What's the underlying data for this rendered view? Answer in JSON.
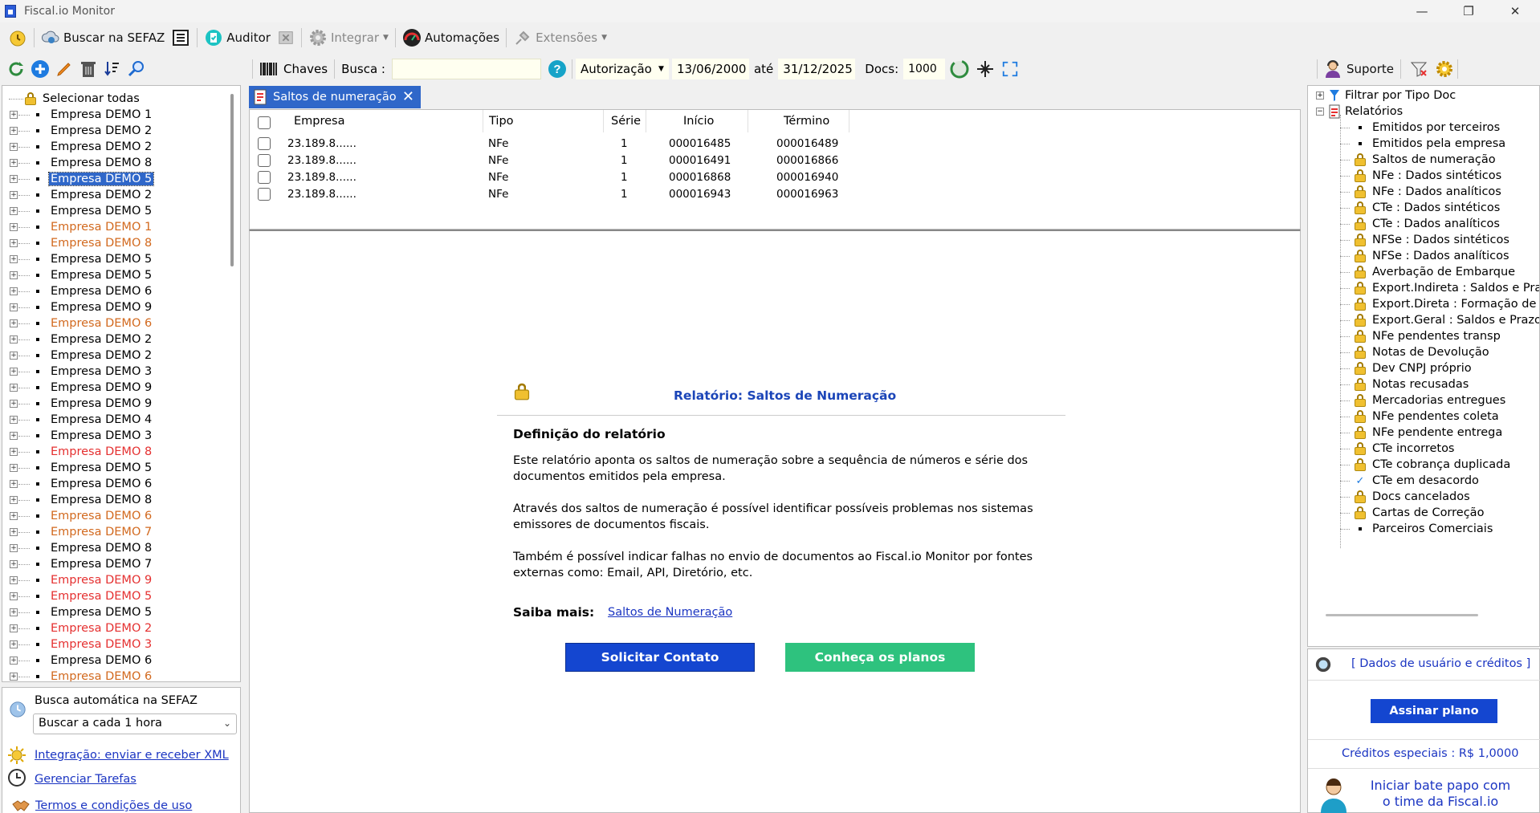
{
  "window": {
    "title": "Fiscal.io Monitor",
    "minimize": "—",
    "maximize": "❐",
    "close": "✕"
  },
  "toolbar": {
    "buscar_sefaz": "Buscar na SEFAZ",
    "auditor": "Auditor",
    "integrar": "Integrar",
    "automacoes": "Automações",
    "extensoes": "Extensões"
  },
  "filterbar": {
    "chaves": "Chaves",
    "busca_label": "Busca :",
    "busca_value": "",
    "autorizacao": "Autorização",
    "date_from": "13/06/2000",
    "ate": "até",
    "date_to": "31/12/2025",
    "docs_label": "Docs:",
    "docs_value": "1000"
  },
  "tree": {
    "select_all": "Selecionar todas",
    "companies": [
      {
        "name": "Empresa DEMO 1",
        "color": "#000000"
      },
      {
        "name": "Empresa DEMO 2",
        "color": "#000000"
      },
      {
        "name": "Empresa DEMO 2",
        "color": "#000000"
      },
      {
        "name": "Empresa DEMO 8",
        "color": "#000000"
      },
      {
        "name": "Empresa DEMO 5",
        "color": "#000000",
        "selected": true
      },
      {
        "name": "Empresa DEMO 2",
        "color": "#000000"
      },
      {
        "name": "Empresa DEMO 5",
        "color": "#000000"
      },
      {
        "name": "Empresa DEMO 1",
        "color": "#d2691e"
      },
      {
        "name": "Empresa DEMO 8",
        "color": "#d2691e"
      },
      {
        "name": "Empresa DEMO 5",
        "color": "#000000"
      },
      {
        "name": "Empresa DEMO 5",
        "color": "#000000"
      },
      {
        "name": "Empresa DEMO 6",
        "color": "#000000"
      },
      {
        "name": "Empresa DEMO 9",
        "color": "#000000"
      },
      {
        "name": "Empresa DEMO 6",
        "color": "#d2691e"
      },
      {
        "name": "Empresa DEMO 2",
        "color": "#000000"
      },
      {
        "name": "Empresa DEMO 2",
        "color": "#000000"
      },
      {
        "name": "Empresa DEMO 3",
        "color": "#000000"
      },
      {
        "name": "Empresa DEMO 9",
        "color": "#000000"
      },
      {
        "name": "Empresa DEMO 9",
        "color": "#000000"
      },
      {
        "name": "Empresa DEMO 4",
        "color": "#000000"
      },
      {
        "name": "Empresa DEMO 3",
        "color": "#000000"
      },
      {
        "name": "Empresa DEMO 8",
        "color": "#e53030"
      },
      {
        "name": "Empresa DEMO 5",
        "color": "#000000"
      },
      {
        "name": "Empresa DEMO 6",
        "color": "#000000"
      },
      {
        "name": "Empresa DEMO 8",
        "color": "#000000"
      },
      {
        "name": "Empresa DEMO 6",
        "color": "#d2691e"
      },
      {
        "name": "Empresa DEMO 7",
        "color": "#d2691e"
      },
      {
        "name": "Empresa DEMO 8",
        "color": "#000000"
      },
      {
        "name": "Empresa DEMO 7",
        "color": "#000000"
      },
      {
        "name": "Empresa DEMO 9",
        "color": "#e53030"
      },
      {
        "name": "Empresa DEMO 5",
        "color": "#e53030"
      },
      {
        "name": "Empresa DEMO 5",
        "color": "#000000"
      },
      {
        "name": "Empresa DEMO 2",
        "color": "#e53030"
      },
      {
        "name": "Empresa DEMO 3",
        "color": "#e53030"
      },
      {
        "name": "Empresa DEMO 6",
        "color": "#000000"
      },
      {
        "name": "Empresa DEMO 6",
        "color": "#d2691e"
      }
    ]
  },
  "autosearch": {
    "title": "Busca automática na SEFAZ",
    "interval": "Buscar a cada 1 hora",
    "integracao": "Integração: enviar e receber XML",
    "tarefas": "Gerenciar Tarefas",
    "termos": "Termos e condições de uso"
  },
  "tab": {
    "label": "Saltos de numeração"
  },
  "grid": {
    "headers": [
      "Empresa",
      "Tipo",
      "Série",
      "Início",
      "Término"
    ],
    "rows": [
      {
        "empresa": "23.189.8......",
        "tipo": "NFe",
        "serie": "1",
        "inicio": "000016485",
        "termino": "000016489"
      },
      {
        "empresa": "23.189.8......",
        "tipo": "NFe",
        "serie": "1",
        "inicio": "000016491",
        "termino": "000016866"
      },
      {
        "empresa": "23.189.8......",
        "tipo": "NFe",
        "serie": "1",
        "inicio": "000016868",
        "termino": "000016940"
      },
      {
        "empresa": "23.189.8......",
        "tipo": "NFe",
        "serie": "1",
        "inicio": "000016943",
        "termino": "000016963"
      }
    ]
  },
  "report": {
    "title": "Relatório: Saltos de Numeração",
    "section": "Definição do relatório",
    "p1a": "Este relatório aponta os saltos de numeração sobre a sequência de números e série dos",
    "p1b": "documentos emitidos pela empresa.",
    "p2a": "Através dos saltos de numeração é possível identificar possíveis problemas nos sistemas",
    "p2b": "emissores de documentos fiscais.",
    "p3a": "Também é possível indicar falhas no envio de documentos ao Fiscal.io Monitor por fontes",
    "p3b": "externas como: Email, API, Diretório, etc.",
    "saiba_label": "Saiba mais:",
    "saiba_link": "Saltos de Numeração",
    "btn_contato": "Solicitar Contato",
    "btn_planos": "Conheça os planos",
    "color_contato": "#1446d0",
    "color_planos": "#2ec27e"
  },
  "right": {
    "suporte": "Suporte",
    "filtrar": "Filtrar por Tipo Doc",
    "relatorios": "Relatórios",
    "items": [
      {
        "label": "Emitidos por terceiros",
        "icon": "bullet"
      },
      {
        "label": "Emitidos pela empresa",
        "icon": "bullet"
      },
      {
        "label": "Saltos de numeração",
        "icon": "lock"
      },
      {
        "label": "NFe : Dados sintéticos",
        "icon": "lock"
      },
      {
        "label": "NFe : Dados analíticos",
        "icon": "lock"
      },
      {
        "label": "CTe : Dados sintéticos",
        "icon": "lock"
      },
      {
        "label": "CTe : Dados analíticos",
        "icon": "lock"
      },
      {
        "label": "NFSe : Dados sintéticos",
        "icon": "lock"
      },
      {
        "label": "NFSe : Dados analíticos",
        "icon": "lock"
      },
      {
        "label": "Averbação de Embarque",
        "icon": "lock"
      },
      {
        "label": "Export.Indireta : Saldos e Pra",
        "icon": "lock"
      },
      {
        "label": "Export.Direta : Formação de l",
        "icon": "lock"
      },
      {
        "label": "Export.Geral : Saldos e Prazo",
        "icon": "lock"
      },
      {
        "label": "NFe pendentes transp",
        "icon": "lock"
      },
      {
        "label": "Notas de Devolução",
        "icon": "lock"
      },
      {
        "label": "Dev CNPJ próprio",
        "icon": "lock"
      },
      {
        "label": "Notas recusadas",
        "icon": "lock"
      },
      {
        "label": "Mercadorias entregues",
        "icon": "lock"
      },
      {
        "label": "NFe pendentes coleta",
        "icon": "lock"
      },
      {
        "label": "NFe pendente entrega",
        "icon": "lock"
      },
      {
        "label": "CTe incorretos",
        "icon": "lock"
      },
      {
        "label": "CTe cobrança duplicada",
        "icon": "lock"
      },
      {
        "label": "CTe em desacordo",
        "icon": "check"
      },
      {
        "label": "Docs cancelados",
        "icon": "lock"
      },
      {
        "label": "Cartas de Correção",
        "icon": "lock"
      },
      {
        "label": "Parceiros Comerciais",
        "icon": "bullet"
      }
    ],
    "dados_usuario": "[ Dados de usuário e créditos ]",
    "assinar": "Assinar plano",
    "creditos": "Créditos especiais : R$ 1,0000",
    "chat1": "Iniciar bate papo com",
    "chat2": "o time da Fiscal.io"
  }
}
